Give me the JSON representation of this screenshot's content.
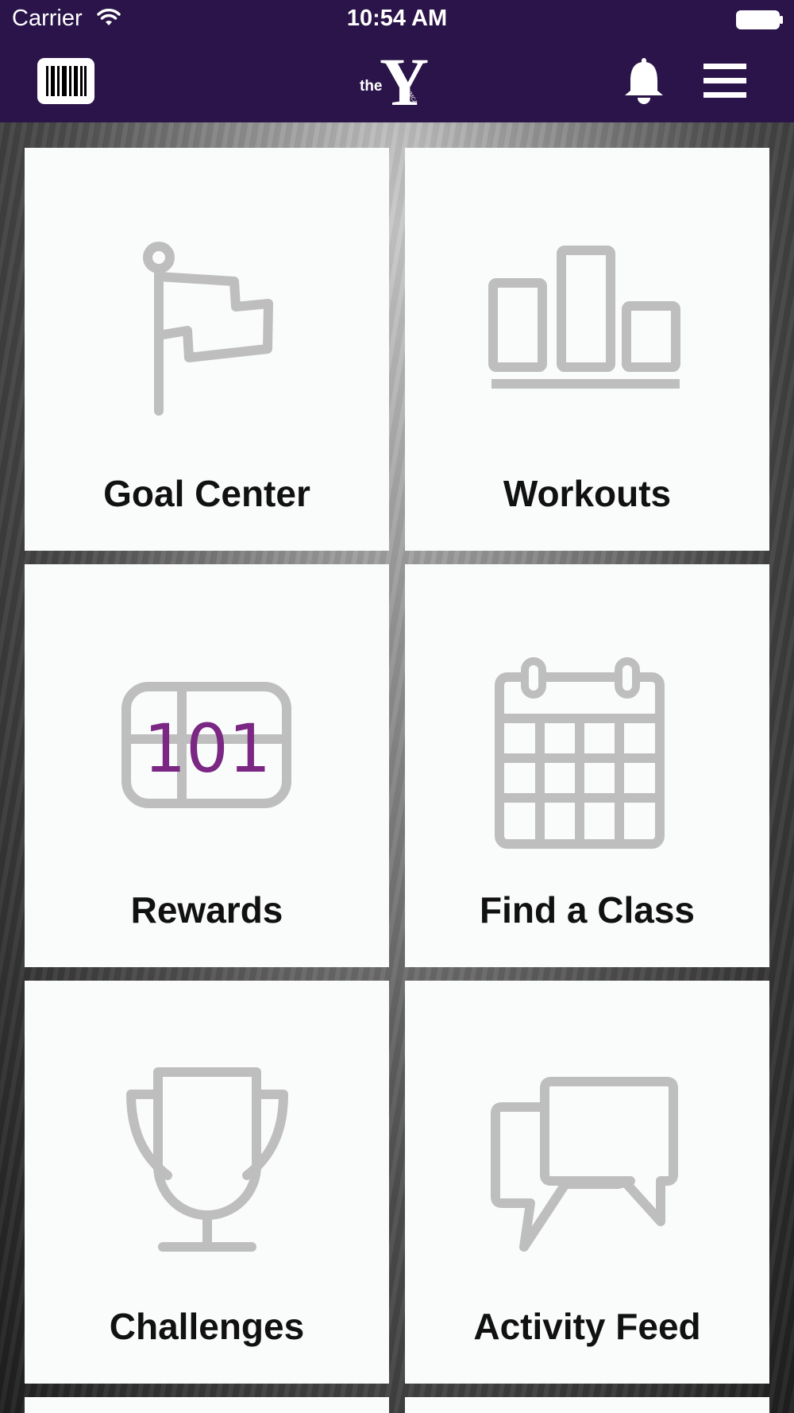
{
  "status_bar": {
    "carrier": "Carrier",
    "time": "10:54 AM",
    "wifi_icon": "wifi-icon",
    "battery_icon": "battery-full-icon"
  },
  "nav": {
    "logo_text": "the",
    "logo_letter": "Y",
    "logo_side_text": "YMCA",
    "left_icon": "barcode-icon",
    "right_icons": [
      "bell-icon",
      "hamburger-menu-icon"
    ]
  },
  "tiles": [
    {
      "label": "Goal Center",
      "icon": "flag-icon"
    },
    {
      "label": "Workouts",
      "icon": "bar-chart-icon"
    },
    {
      "label": "Rewards",
      "icon": "rewards-card-icon",
      "value": "101"
    },
    {
      "label": "Find a Class",
      "icon": "calendar-icon"
    },
    {
      "label": "Challenges",
      "icon": "trophy-icon"
    },
    {
      "label": "Activity Feed",
      "icon": "chat-bubbles-icon"
    }
  ],
  "colors": {
    "header_bg": "#2a1449",
    "tile_bg": "#fafcfb",
    "icon_gray": "#bebebe",
    "rewards_accent": "#7b2784",
    "label_text": "#111111"
  }
}
